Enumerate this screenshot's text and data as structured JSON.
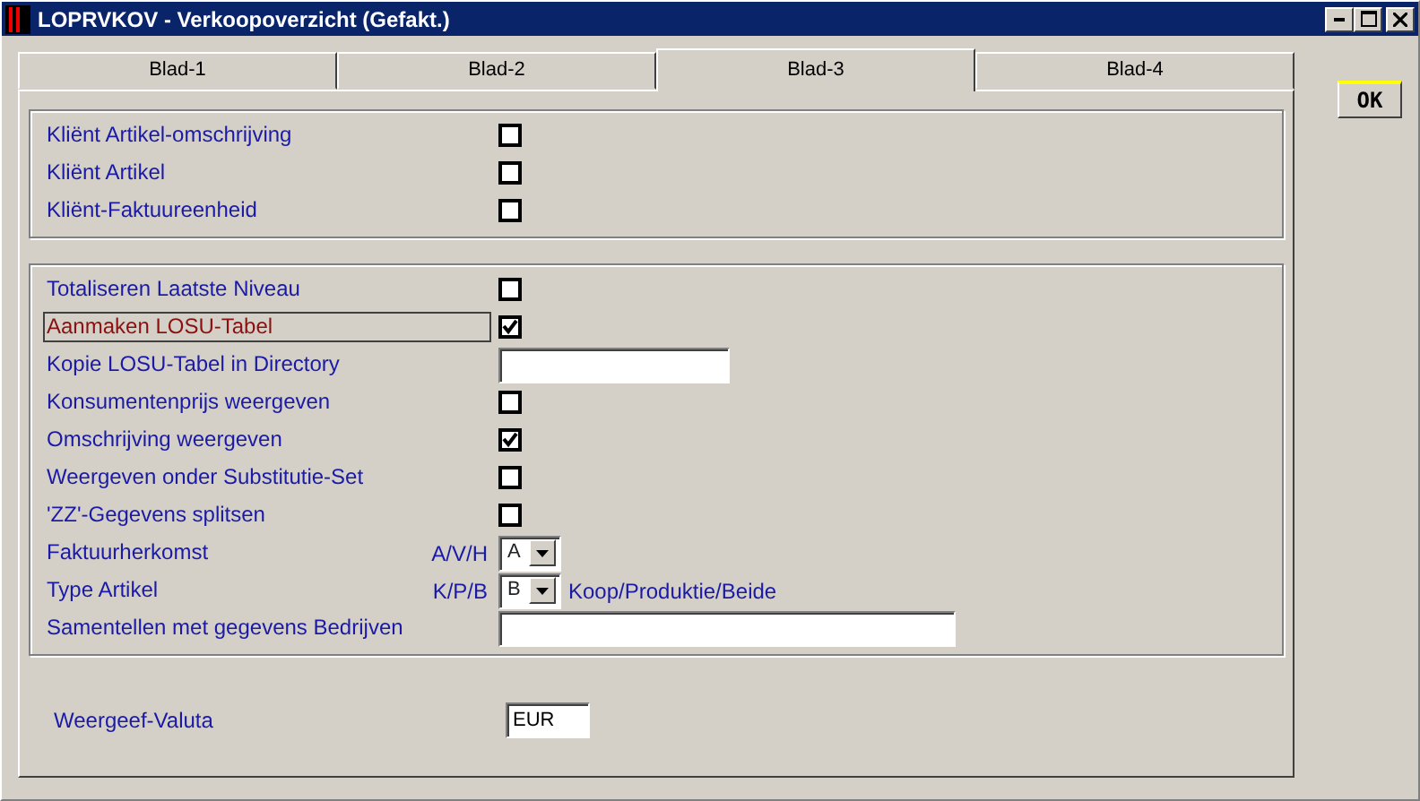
{
  "window": {
    "title": "LOPRVKOV - Verkoopoverzicht (Gefakt.)"
  },
  "tabs": [
    {
      "label": "Blad-1",
      "selected": false
    },
    {
      "label": "Blad-2",
      "selected": false
    },
    {
      "label": "Blad-3",
      "selected": true
    },
    {
      "label": "Blad-4",
      "selected": false
    }
  ],
  "ok_button": "OK",
  "groups": [
    {
      "rows": [
        {
          "kind": "checkbox",
          "label": "Kliënt Artikel-omschrijving",
          "checked": false,
          "focused": false
        },
        {
          "kind": "checkbox",
          "label": "Kliënt Artikel",
          "checked": false,
          "focused": false
        },
        {
          "kind": "checkbox",
          "label": "Kliënt-Faktuureenheid",
          "checked": false,
          "focused": false
        }
      ]
    },
    {
      "rows": [
        {
          "kind": "checkbox",
          "label": "Totaliseren Laatste Niveau",
          "checked": false,
          "focused": false
        },
        {
          "kind": "checkbox",
          "label": "Aanmaken LOSU-Tabel",
          "checked": true,
          "focused": true
        },
        {
          "kind": "text",
          "label": "Kopie LOSU-Tabel in Directory",
          "focused": false
        },
        {
          "kind": "checkbox",
          "label": "Konsumentenprijs weergeven",
          "checked": false,
          "focused": false
        },
        {
          "kind": "checkbox",
          "label": "Omschrijving weergeven",
          "checked": true,
          "focused": false
        },
        {
          "kind": "checkbox",
          "label": "Weergeven onder Substitutie-Set",
          "checked": false,
          "focused": false
        },
        {
          "kind": "checkbox",
          "label": "'ZZ'-Gegevens splitsen",
          "checked": false,
          "focused": false
        },
        {
          "kind": "select",
          "label": "Faktuurherkomst",
          "code": "A/V/H",
          "value": "A",
          "focused": false
        },
        {
          "kind": "select",
          "label": "Type Artikel",
          "code": "K/P/B",
          "value": "B",
          "hint": "Koop/Produktie/Beide",
          "focused": false
        },
        {
          "kind": "widetext",
          "label": "Samentellen met gegevens Bedrijven",
          "focused": false
        }
      ]
    }
  ],
  "currency": {
    "label": "Weergeef-Valuta",
    "value": "EUR"
  }
}
